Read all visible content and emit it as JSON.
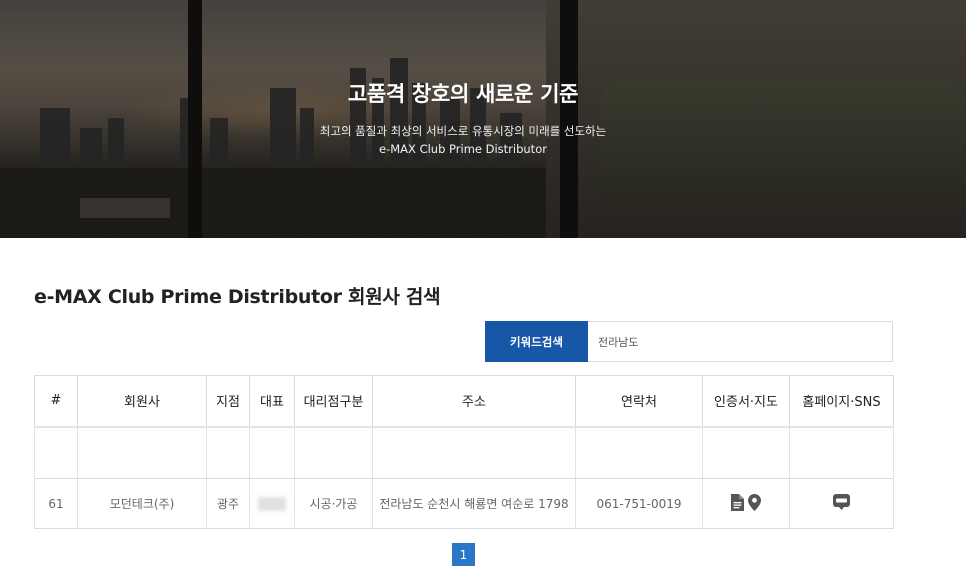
{
  "hero": {
    "title": "고품격 창호의 새로운 기준",
    "subtitle_line1": "최고의 품질과 최상의 서비스로 유통시장의 미래를 선도하는",
    "subtitle_line2": "e-MAX Club Prime Distributor"
  },
  "page_title": "e-MAX Club Prime Distributor 회원사 검색",
  "search": {
    "button_label": "키워드검색",
    "value": "전라남도"
  },
  "table": {
    "headers": [
      "#",
      "회원사",
      "지점",
      "대표",
      "대리점구분",
      "주소",
      "연락처",
      "인증서·지도",
      "홈페이지·SNS"
    ],
    "rows": [
      {
        "no": "61",
        "company": "모던테크(주)",
        "branch": "광주",
        "type": "시공·가공",
        "address": "전라남도 순천시 해룡면 여순로 1798",
        "phone": "061-751-0019"
      }
    ]
  },
  "icons": {
    "certificate": "document-icon",
    "map": "map-pin-icon",
    "homepage": "blog-icon"
  },
  "pagination": {
    "current": "1"
  },
  "colors": {
    "accent": "#1757a8",
    "pager": "#2a77c6"
  }
}
